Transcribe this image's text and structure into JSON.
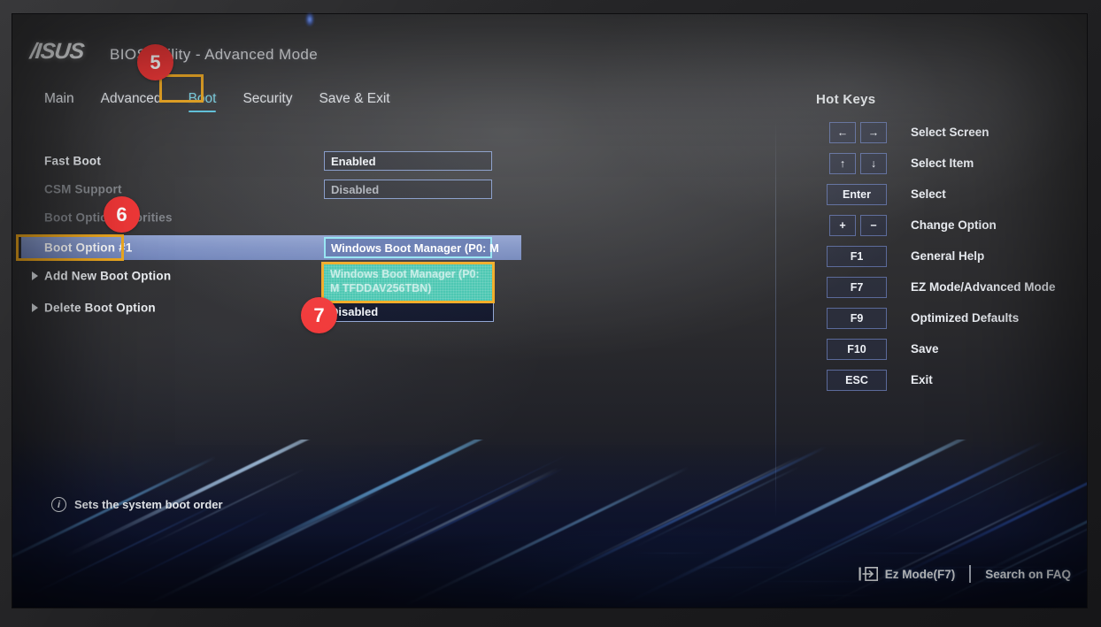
{
  "header": {
    "brand": "/ISUS",
    "title": "BIOS Utility - Advanced Mode"
  },
  "menu": {
    "items": [
      {
        "label": "Main",
        "active": false
      },
      {
        "label": "Advanced",
        "active": false
      },
      {
        "label": "Boot",
        "active": true
      },
      {
        "label": "Security",
        "active": false
      },
      {
        "label": "Save & Exit",
        "active": false
      }
    ]
  },
  "settings": {
    "rows": [
      {
        "label": "Fast Boot",
        "value": "Enabled",
        "state": "normal"
      },
      {
        "label": "CSM Support",
        "value": "Disabled",
        "state": "dim"
      },
      {
        "label": "Boot Option Priorities",
        "value": "",
        "state": "header"
      },
      {
        "label": "Boot Option #1",
        "value": "Windows Boot Manager (P0: M",
        "state": "selected"
      },
      {
        "label": "Add New Boot Option",
        "value": "",
        "state": "submenu"
      },
      {
        "label": "Delete Boot Option",
        "value": "",
        "state": "submenu"
      }
    ]
  },
  "dropdown": {
    "options": [
      {
        "label": "Windows Boot Manager (P0: M TFDDAV256TBN)",
        "highlighted": true
      },
      {
        "label": "Disabled",
        "highlighted": false
      }
    ]
  },
  "hotkeys": {
    "title": "Hot Keys",
    "rows": [
      {
        "keys": [
          "←",
          "→"
        ],
        "label": "Select Screen"
      },
      {
        "keys": [
          "↑",
          "↓"
        ],
        "label": "Select Item"
      },
      {
        "keys": [
          "Enter"
        ],
        "label": "Select"
      },
      {
        "keys": [
          "+",
          "−"
        ],
        "label": "Change Option"
      },
      {
        "keys": [
          "F1"
        ],
        "label": "General Help"
      },
      {
        "keys": [
          "F7"
        ],
        "label": "EZ Mode/Advanced Mode"
      },
      {
        "keys": [
          "F9"
        ],
        "label": "Optimized Defaults"
      },
      {
        "keys": [
          "F10"
        ],
        "label": "Save"
      },
      {
        "keys": [
          "ESC"
        ],
        "label": "Exit"
      }
    ]
  },
  "help": {
    "icon": "info-icon",
    "text": "Sets the system boot order"
  },
  "bottombar": {
    "ez_mode": "Ez Mode(F7)",
    "search": "Search on FAQ"
  },
  "annotations": {
    "badges": [
      {
        "number": "5"
      },
      {
        "number": "6"
      },
      {
        "number": "7"
      }
    ],
    "highlight_color": "#f0a81c",
    "badge_color": "#f03232"
  },
  "theme": {
    "accent_cyan": "#7fdcef",
    "selected_row": "#7b8ec2",
    "dropdown_highlight": "#3fc3ac",
    "keycap_border": "#5b6a9a"
  }
}
